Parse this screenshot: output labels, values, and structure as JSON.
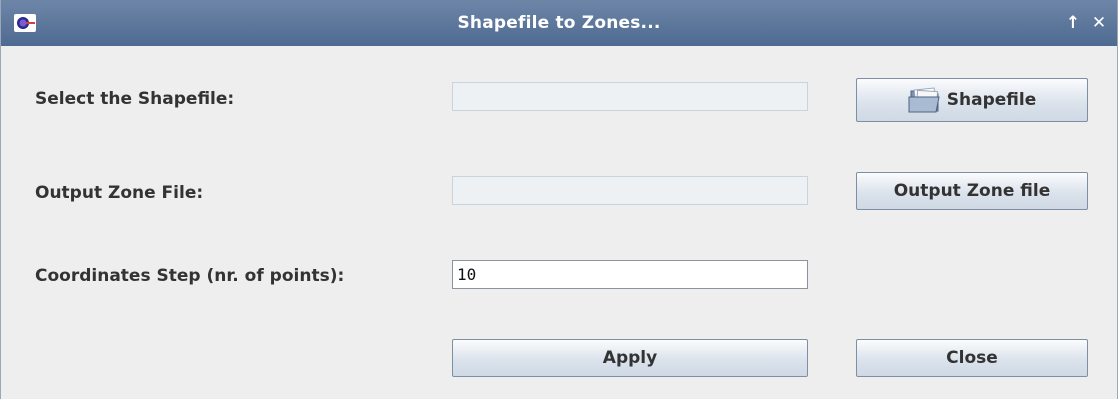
{
  "window": {
    "title": "Shapefile to Zones...",
    "maximize_glyph": "↑",
    "close_glyph": "✕"
  },
  "form": {
    "shapefile_label": "Select the Shapefile:",
    "shapefile_value": "",
    "shapefile_button": "Shapefile",
    "output_label": "Output Zone File:",
    "output_value": "",
    "output_button": "Output Zone file",
    "step_label": "Coordinates Step (nr. of points):",
    "step_value": "10"
  },
  "actions": {
    "apply_label": "Apply",
    "close_label": "Close"
  },
  "icons": {
    "app": "app-icon",
    "shapefile_button": "folder-open-icon"
  }
}
